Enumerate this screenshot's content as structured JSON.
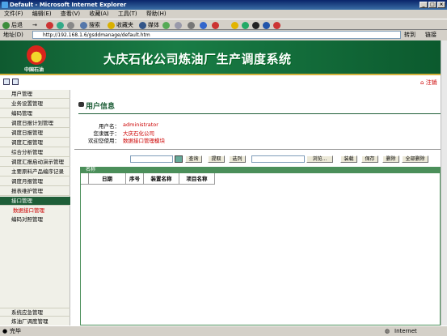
{
  "window": {
    "title": "Default - Microsoft Internet Explorer"
  },
  "menu": [
    "文件(F)",
    "编辑(E)",
    "查看(V)",
    "收藏(A)",
    "工具(T)",
    "帮助(H)"
  ],
  "toolbar": {
    "back": "后退",
    "search": "搜索",
    "favorites": "收藏夹",
    "media": "媒体"
  },
  "address": {
    "label": "地址(D)",
    "url": "http://192.168.1.6/gsddmanage/default.htm",
    "go": "转到",
    "links": "链接"
  },
  "banner": {
    "logo_text": "中国石油",
    "title": "大庆石化公司炼油厂生产调度系统"
  },
  "header": {
    "logout": "注销"
  },
  "sidebar": {
    "items": [
      "用户管理",
      "业务设置管理",
      "编码管理",
      "调度日报计划管理",
      "调度日报管理",
      "调度汇报管理",
      "综合分析管理",
      "调度汇报启动演示管理",
      "主要原料产品编序记录",
      "调度月报管理",
      "报表维护管理",
      "接口管理"
    ],
    "sub_item": "数据接口管理",
    "sub_item2": "编码对照管理",
    "bottom": [
      "系统应急管理",
      "炼油厂调度管理"
    ]
  },
  "user_info": {
    "title": "用户信息",
    "rows": [
      {
        "label": "用户名：",
        "value": "administrator"
      },
      {
        "label": "您隶属于：",
        "value": "大庆石化公司"
      },
      {
        "label": "欢迎您使用：",
        "value": "数据接口管理模块"
      }
    ]
  },
  "actions": {
    "query": "查询",
    "extract": "提取",
    "select": "选列",
    "browse": "浏览...",
    "load": "装载",
    "save": "保存",
    "delete": "删除",
    "delete_all": "全部删除"
  },
  "grid": {
    "tab": "名称",
    "columns": [
      "",
      "日期",
      "序号",
      "装置名称",
      "项目名称"
    ]
  },
  "status": {
    "left": "完毕",
    "right": "Internet"
  }
}
